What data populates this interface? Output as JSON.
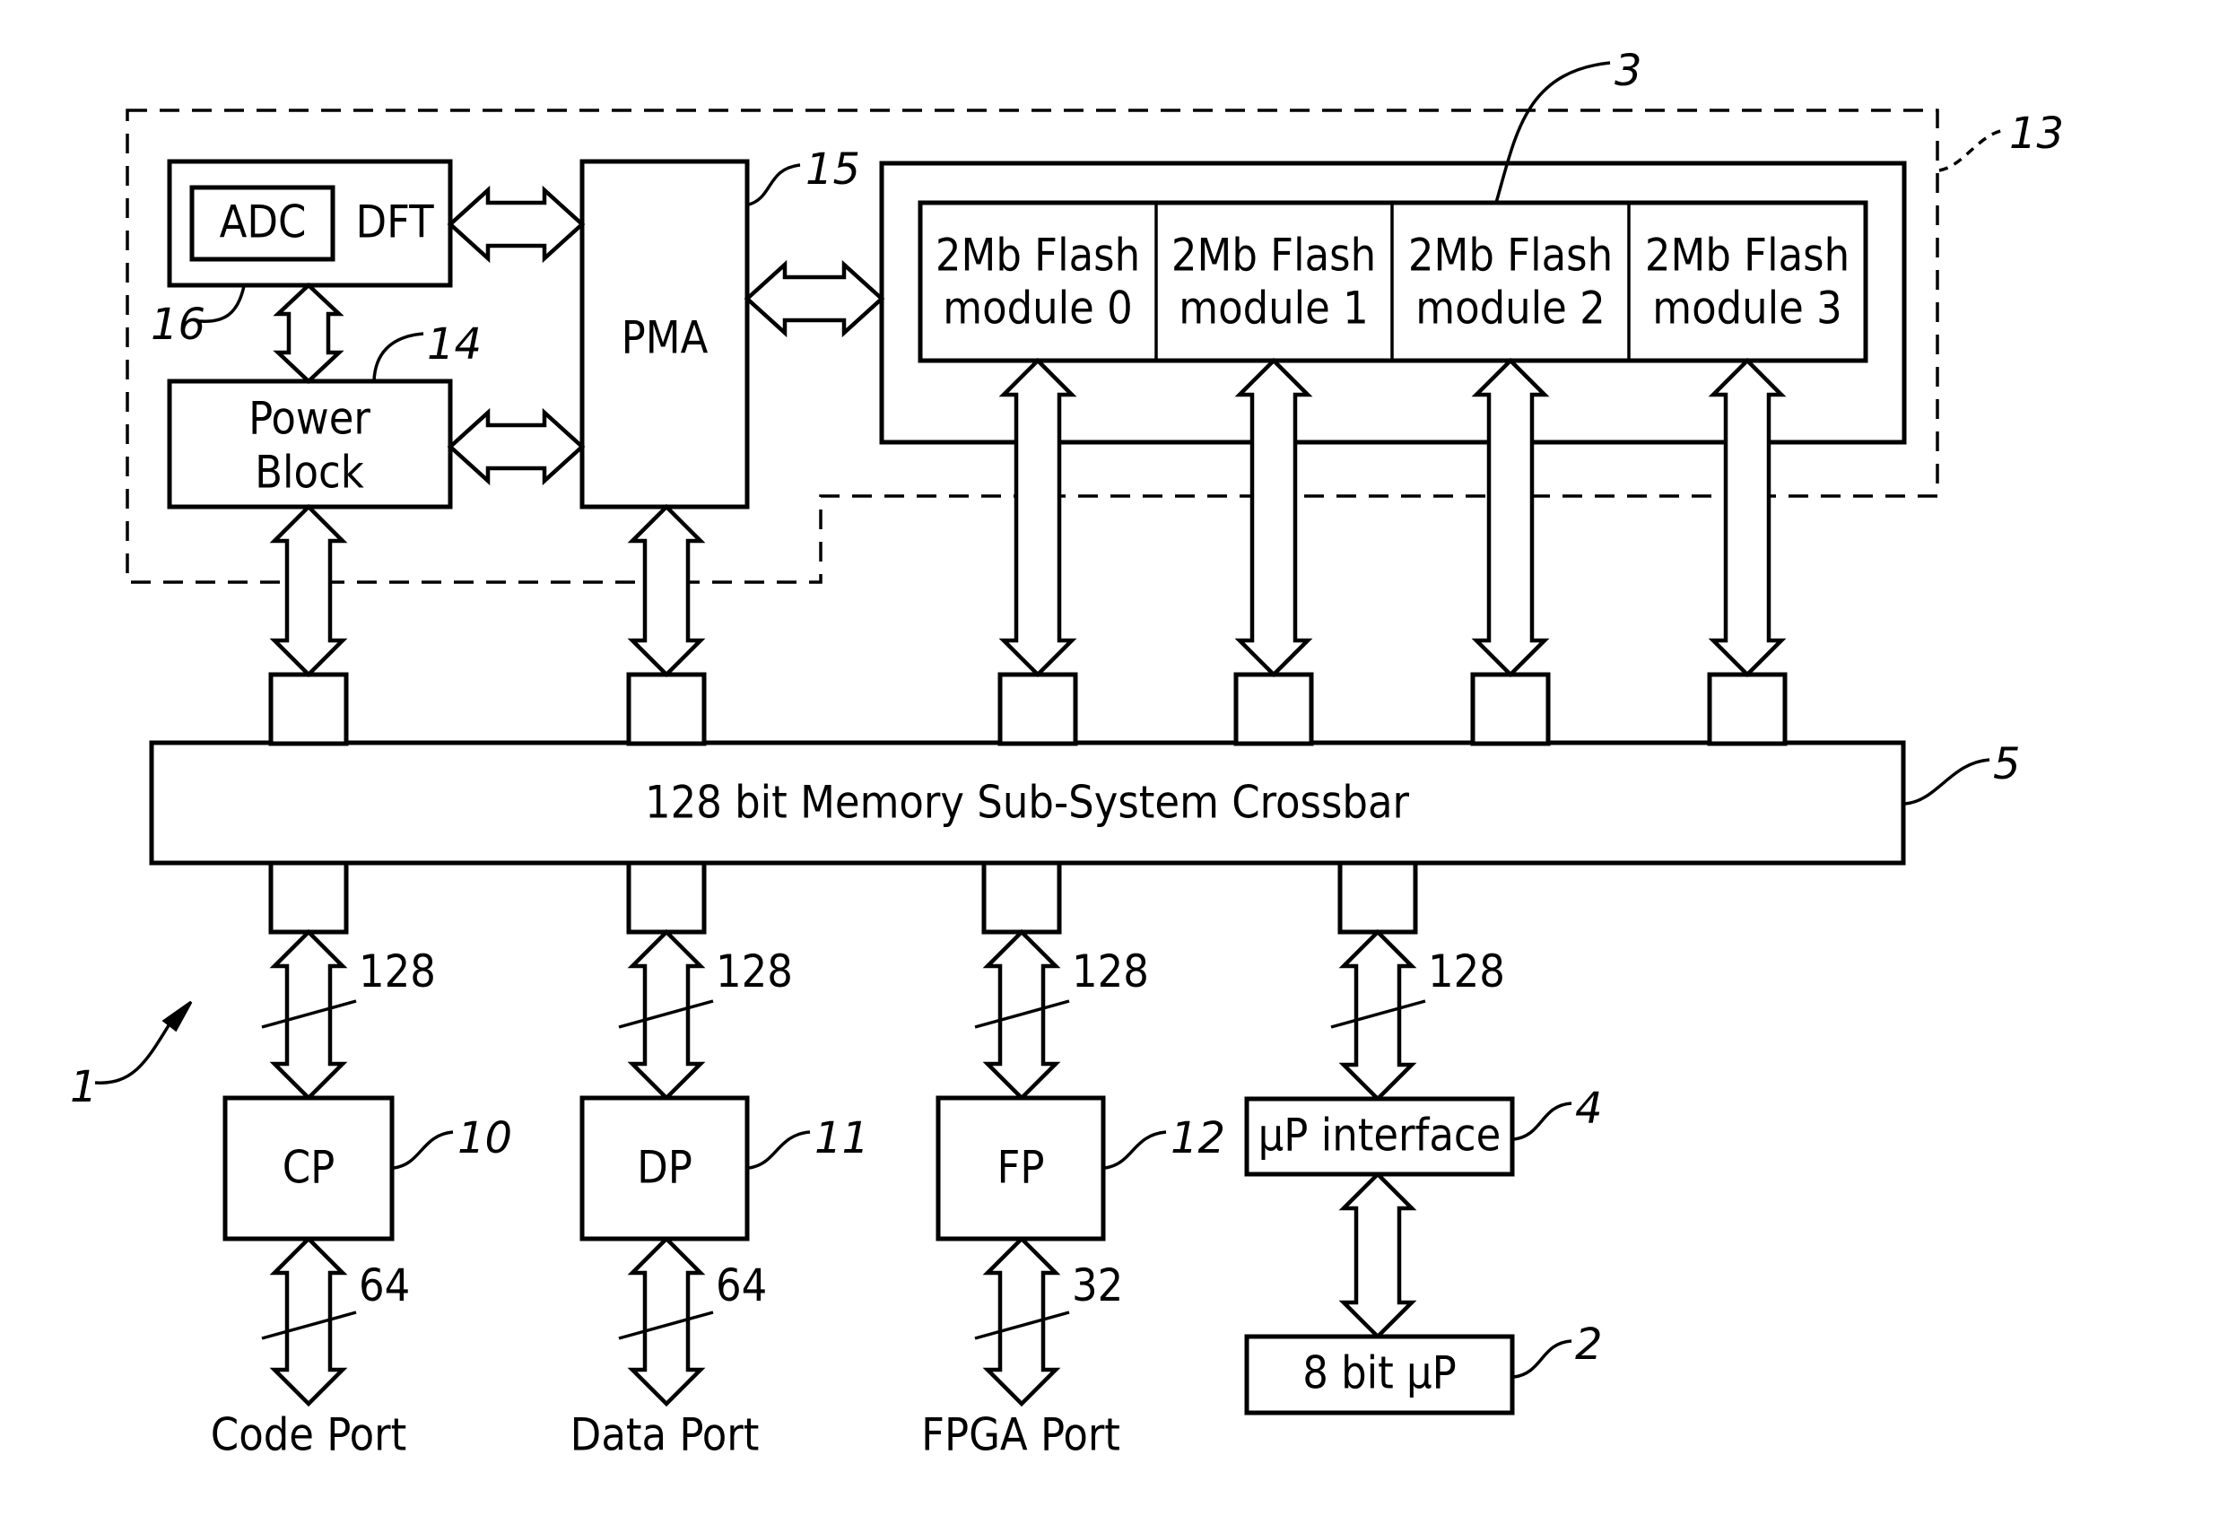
{
  "figure": {
    "system_ref": "1",
    "region_ref": "13",
    "blocks": {
      "dft": {
        "label": "DFT",
        "ref": "16"
      },
      "adc": {
        "label": "ADC"
      },
      "power_block": {
        "label_line1": "Power",
        "label_line2": "Block",
        "ref": "14"
      },
      "pma": {
        "label": "PMA",
        "ref": "15"
      },
      "flash_array": {
        "ref": "3"
      },
      "flash_modules": [
        {
          "line1": "2Mb Flash",
          "line2": "module 0"
        },
        {
          "line1": "2Mb Flash",
          "line2": "module 1"
        },
        {
          "line1": "2Mb Flash",
          "line2": "module 2"
        },
        {
          "line1": "2Mb Flash",
          "line2": "module 3"
        }
      ],
      "crossbar": {
        "label": "128 bit Memory Sub-System Crossbar",
        "ref": "5"
      },
      "cp": {
        "label": "CP",
        "ref": "10",
        "upper_bus_width": "128",
        "lower_bus_width": "64",
        "port_label": "Code Port"
      },
      "dp": {
        "label": "DP",
        "ref": "11",
        "upper_bus_width": "128",
        "lower_bus_width": "64",
        "port_label": "Data Port"
      },
      "fp": {
        "label": "FP",
        "ref": "12",
        "upper_bus_width": "128",
        "lower_bus_width": "32",
        "port_label": "FPGA Port"
      },
      "up_interface": {
        "label": "μP interface",
        "ref": "4",
        "upper_bus_width": "128"
      },
      "up_8bit": {
        "label": "8 bit μP",
        "ref": "2"
      }
    }
  }
}
